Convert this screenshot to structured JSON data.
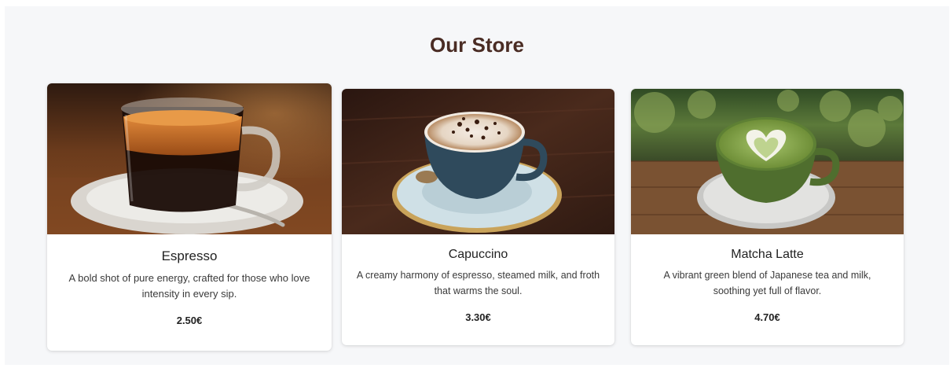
{
  "store": {
    "title": "Our Store",
    "products": [
      {
        "name": "Espresso",
        "description": "A bold shot of pure energy, crafted for those who love intensity in every sip.",
        "price": "2.50€",
        "image_icon": "espresso-photo"
      },
      {
        "name": "Capuccino",
        "description": "A creamy harmony of espresso, steamed milk, and froth that warms the soul.",
        "price": "3.30€",
        "image_icon": "cappuccino-photo"
      },
      {
        "name": "Matcha Latte",
        "description": "A vibrant green blend of Japanese tea and milk, soothing yet full of flavor.",
        "price": "4.70€",
        "image_icon": "matcha-latte-photo"
      }
    ]
  },
  "colors": {
    "title": "#4a2c24",
    "background": "#f6f7f9",
    "card": "#ffffff"
  }
}
